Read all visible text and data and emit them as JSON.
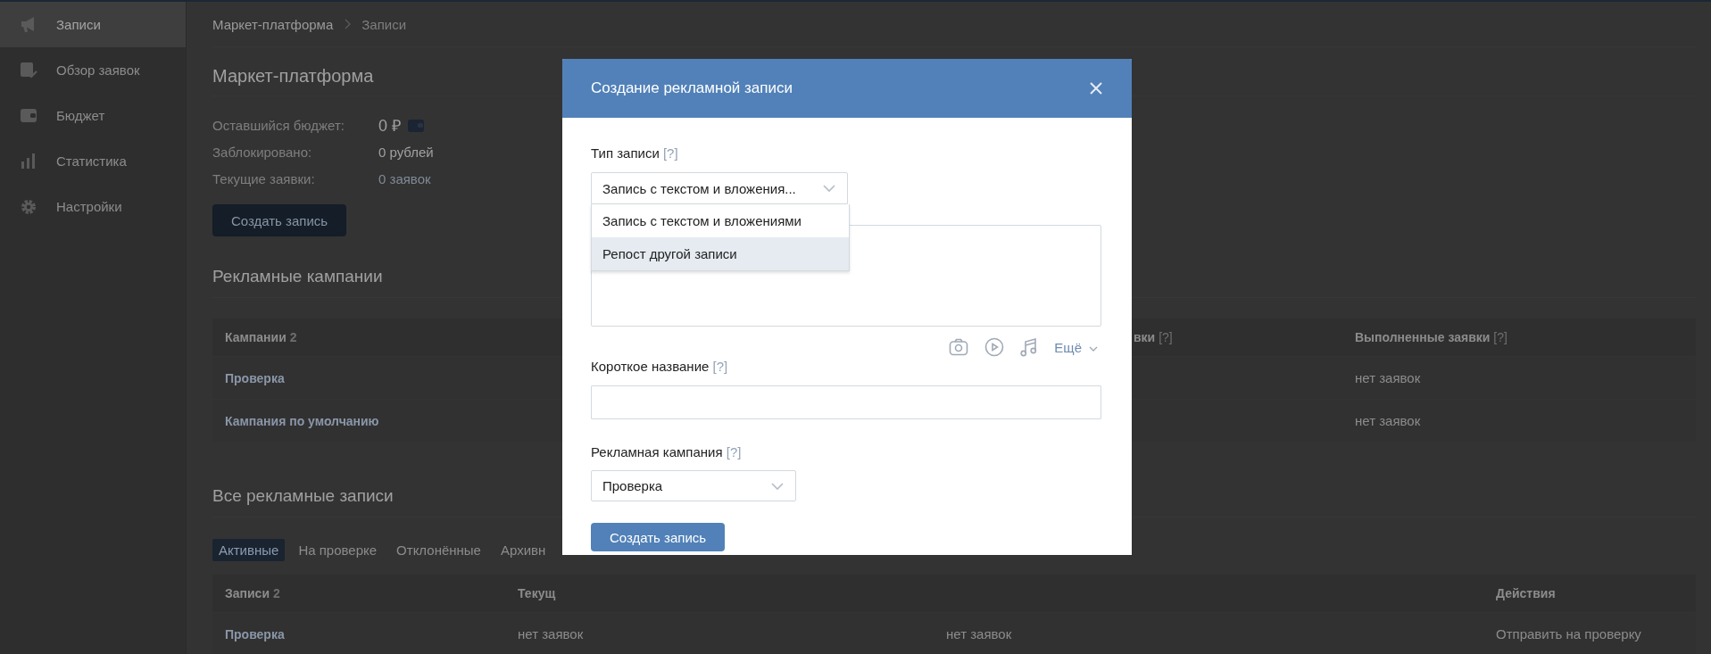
{
  "sidebar": {
    "items": [
      {
        "label": "Записи",
        "selected": true
      },
      {
        "label": "Обзор заявок",
        "selected": false
      },
      {
        "label": "Бюджет",
        "selected": false
      },
      {
        "label": "Статистика",
        "selected": false
      },
      {
        "label": "Настройки",
        "selected": false
      }
    ]
  },
  "breadcrumb": [
    "Маркет-платформа",
    "Записи"
  ],
  "page_title": "Маркет-платформа",
  "budget": [
    {
      "kind": "balance",
      "label": "Оставшийся бюджет:",
      "value": "0 ₽"
    },
    {
      "kind": "plain",
      "label": "Заблокировано:",
      "value": "0 рублей"
    },
    {
      "kind": "muted",
      "label": "Текущие заявки:",
      "value": "0 заявок"
    }
  ],
  "create_button": "Создать запись",
  "campaigns": {
    "title": "Рекламные кампании",
    "columns": [
      {
        "label": "Кампании",
        "count": "2"
      },
      {
        "label": "вки",
        "hint": "[?]"
      },
      {
        "label": "Выполненные заявки",
        "hint": "[?]"
      }
    ],
    "rows": [
      {
        "name": "Проверка",
        "completed": "нет заявок"
      },
      {
        "name": "Кампания по умолчанию",
        "completed": "нет заявок"
      }
    ]
  },
  "posts": {
    "title": "Все рекламные записи",
    "tabs": [
      {
        "label": "Активные",
        "selected": true
      },
      {
        "label": "На проверке",
        "selected": false
      },
      {
        "label": "Отклонённые",
        "selected": false
      },
      {
        "label": "Архивн",
        "selected": false
      }
    ],
    "columns": [
      {
        "label": "Записи",
        "count": "2"
      },
      {
        "label": "Текущ"
      },
      {
        "label": "Действия"
      }
    ],
    "rows": [
      {
        "name": "Проверка",
        "current": "нет заявок",
        "column_3": "нет заявок",
        "action": "Отправить на проверку"
      }
    ]
  },
  "modal": {
    "title": "Создание рекламной записи",
    "fields": [
      {
        "kind": "select",
        "label": "Тип записи",
        "hint": "[?]",
        "value": "Запись с текстом и вложения...",
        "expanded": true,
        "options": [
          {
            "label": "Запись с текстом и вложениями",
            "selected": false
          },
          {
            "label": "Репост другой записи",
            "selected": true
          }
        ]
      },
      {
        "kind": "textarea"
      },
      {
        "kind": "attachments",
        "more": "Ещё"
      },
      {
        "kind": "input",
        "label": "Короткое название",
        "hint": "[?]"
      },
      {
        "kind": "select",
        "label": "Рекламная кампания",
        "hint": "[?]",
        "value": "Проверка",
        "expanded": false
      }
    ],
    "submit": "Создать запись"
  }
}
